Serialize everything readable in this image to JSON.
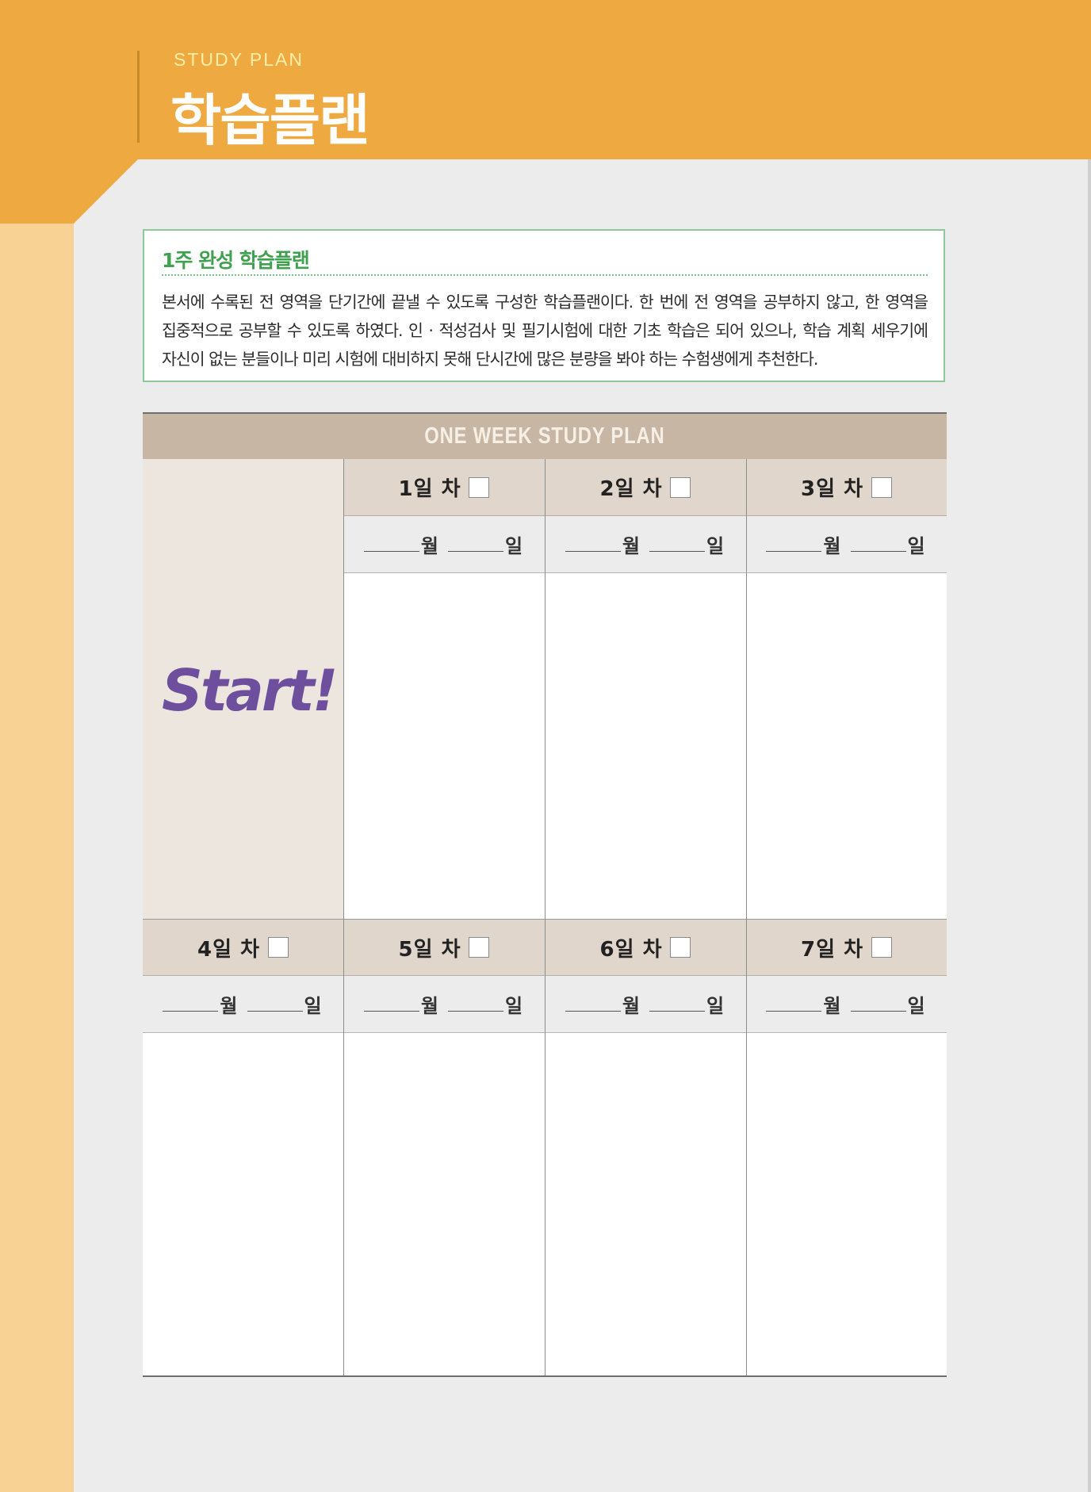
{
  "header": {
    "subtitle": "STUDY PLAN",
    "title": "학습플랜"
  },
  "info": {
    "title": "1주 완성 학습플랜",
    "text": "본서에 수록된 전 영역을 단기간에 끝낼 수 있도록 구성한 학습플랜이다. 한 번에 전 영역을 공부하지 않고, 한 영역을 집중적으로 공부할 수 있도록 하였다. 인 · 적성검사 및 필기시험에 대한 기초 학습은 되어 있으나, 학습 계획 세우기에 자신이 없는 분들이나 미리 시험에 대비하지 못해 단시간에 많은 분량을 봐야 하는 수험생에게 추천한다."
  },
  "plan": {
    "header": "ONE WEEK STUDY PLAN",
    "start": "Start!",
    "month_word": "월",
    "day_word": "일",
    "days": [
      {
        "label": "1일 차"
      },
      {
        "label": "2일 차"
      },
      {
        "label": "3일 차"
      },
      {
        "label": "4일 차"
      },
      {
        "label": "5일 차"
      },
      {
        "label": "6일 차"
      },
      {
        "label": "7일 차"
      }
    ]
  },
  "colors": {
    "band": "#eea940",
    "strip": "#f8d195",
    "accent_green": "#3fa04f",
    "start_purple": "#6e4f9e",
    "table_header": "#c8b6a4"
  }
}
